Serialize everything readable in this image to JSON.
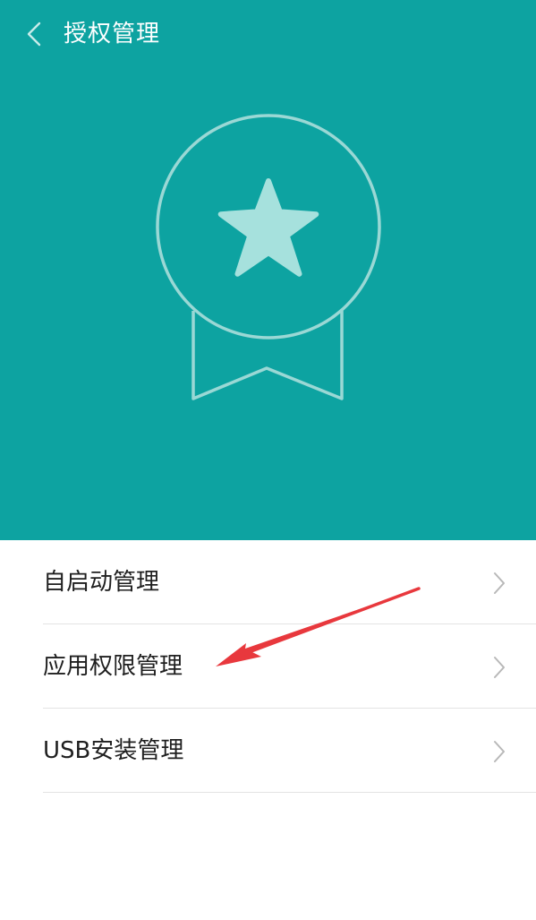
{
  "header": {
    "title": "授权管理",
    "back_icon": "chevron-left-icon",
    "background_color": "#0da3a1"
  },
  "hero": {
    "icon": "award-badge-star-icon",
    "line_color": "#9ad8d5",
    "star_color": "#a6e1dd"
  },
  "menu": {
    "items": [
      {
        "label": "自启动管理",
        "icon": "chevron-right-icon"
      },
      {
        "label": "应用权限管理",
        "icon": "chevron-right-icon"
      },
      {
        "label": "USB安装管理",
        "icon": "chevron-right-icon"
      }
    ]
  },
  "annotation": {
    "arrow_color": "#e8383d",
    "points_to": "应用权限管理"
  }
}
